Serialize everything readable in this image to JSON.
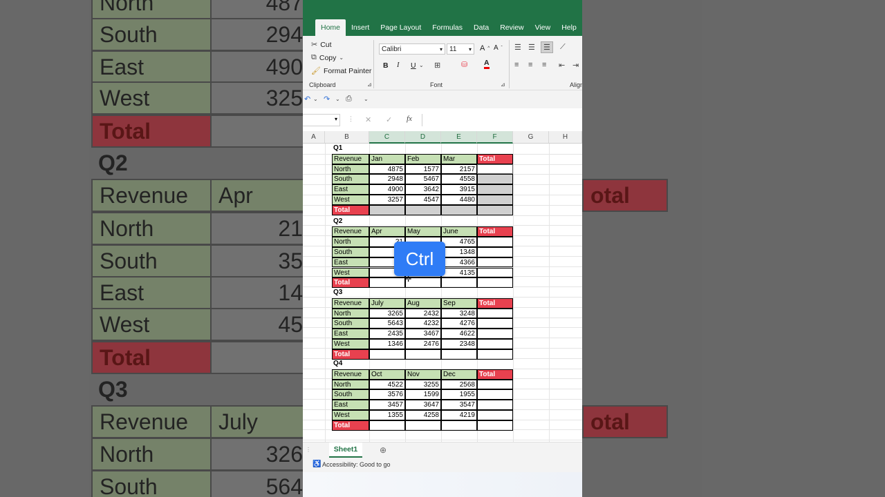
{
  "ribbon_tabs": [
    "Home",
    "Insert",
    "Page Layout",
    "Formulas",
    "Data",
    "Review",
    "View",
    "Help"
  ],
  "clipboard": {
    "cut": "Cut",
    "copy": "Copy",
    "format_painter": "Format Painter",
    "group": "Clipboard"
  },
  "font": {
    "name": "Calibri",
    "size": "11",
    "group": "Font",
    "grow": "A",
    "shrink": "A",
    "bold": "B",
    "italic": "I",
    "underline": "U",
    "color_letter": "A"
  },
  "alignment_group": "Align",
  "formula_bar": {
    "fx": "fx",
    "cancel": "✕",
    "enter": "✓",
    "name_box": "",
    "value": ""
  },
  "columns": [
    "A",
    "B",
    "C",
    "D",
    "E",
    "F",
    "G",
    "H"
  ],
  "quarters": [
    {
      "label": "Q1",
      "months": [
        "Jan",
        "Feb",
        "Mar"
      ],
      "rows": [
        [
          "North",
          "4875",
          "1577",
          "2157"
        ],
        [
          "South",
          "2948",
          "5467",
          "4558"
        ],
        [
          "East",
          "4900",
          "3642",
          "3915"
        ],
        [
          "West",
          "3257",
          "4547",
          "4480"
        ]
      ]
    },
    {
      "label": "Q2",
      "months": [
        "Apr",
        "May",
        "June"
      ],
      "rows": [
        [
          "North",
          "21",
          "",
          "4765"
        ],
        [
          "South",
          "35",
          "",
          "1348"
        ],
        [
          "East",
          "14",
          "",
          "4366"
        ],
        [
          "West",
          "45",
          "",
          "4135"
        ]
      ]
    },
    {
      "label": "Q3",
      "months": [
        "July",
        "Aug",
        "Sep"
      ],
      "rows": [
        [
          "North",
          "3265",
          "2432",
          "3248"
        ],
        [
          "South",
          "5643",
          "4232",
          "4276"
        ],
        [
          "East",
          "2435",
          "3467",
          "4622"
        ],
        [
          "West",
          "1346",
          "2476",
          "2348"
        ]
      ]
    },
    {
      "label": "Q4",
      "months": [
        "Oct",
        "Nov",
        "Dec"
      ],
      "rows": [
        [
          "North",
          "4522",
          "3255",
          "2568"
        ],
        [
          "South",
          "3576",
          "1599",
          "1955"
        ],
        [
          "East",
          "3457",
          "3647",
          "3547"
        ],
        [
          "West",
          "1355",
          "4258",
          "4219"
        ]
      ]
    }
  ],
  "revenue_label": "Revenue",
  "total_label": "Total",
  "sheet_tab": "Sheet1",
  "status": "Accessibility: Good to go",
  "key_overlay": "Ctrl",
  "background_zoom": {
    "rows": [
      {
        "label": "North",
        "num": "487"
      },
      {
        "label": "South",
        "num": "294"
      },
      {
        "label": "East",
        "num": "490"
      },
      {
        "label": "West",
        "num": "325"
      },
      {
        "label": "Total",
        "num": ""
      },
      {
        "label": "Q2",
        "num": ""
      },
      {
        "label": "Revenue",
        "num": "Apr"
      },
      {
        "label": "North",
        "num": "21"
      },
      {
        "label": "South",
        "num": "35"
      },
      {
        "label": "East",
        "num": "14"
      },
      {
        "label": "West",
        "num": "45"
      },
      {
        "label": "Total",
        "num": ""
      },
      {
        "label": "Q3",
        "num": ""
      },
      {
        "label": "Revenue",
        "num": "July"
      },
      {
        "label": "North",
        "num": "326"
      },
      {
        "label": "South",
        "num": "564"
      }
    ],
    "right_total": "otal"
  },
  "colors": {
    "excel_green": "#217346",
    "header_green": "#c6e0b4",
    "total_red": "#e8414f",
    "ctrl_blue": "#2f7cf6"
  }
}
